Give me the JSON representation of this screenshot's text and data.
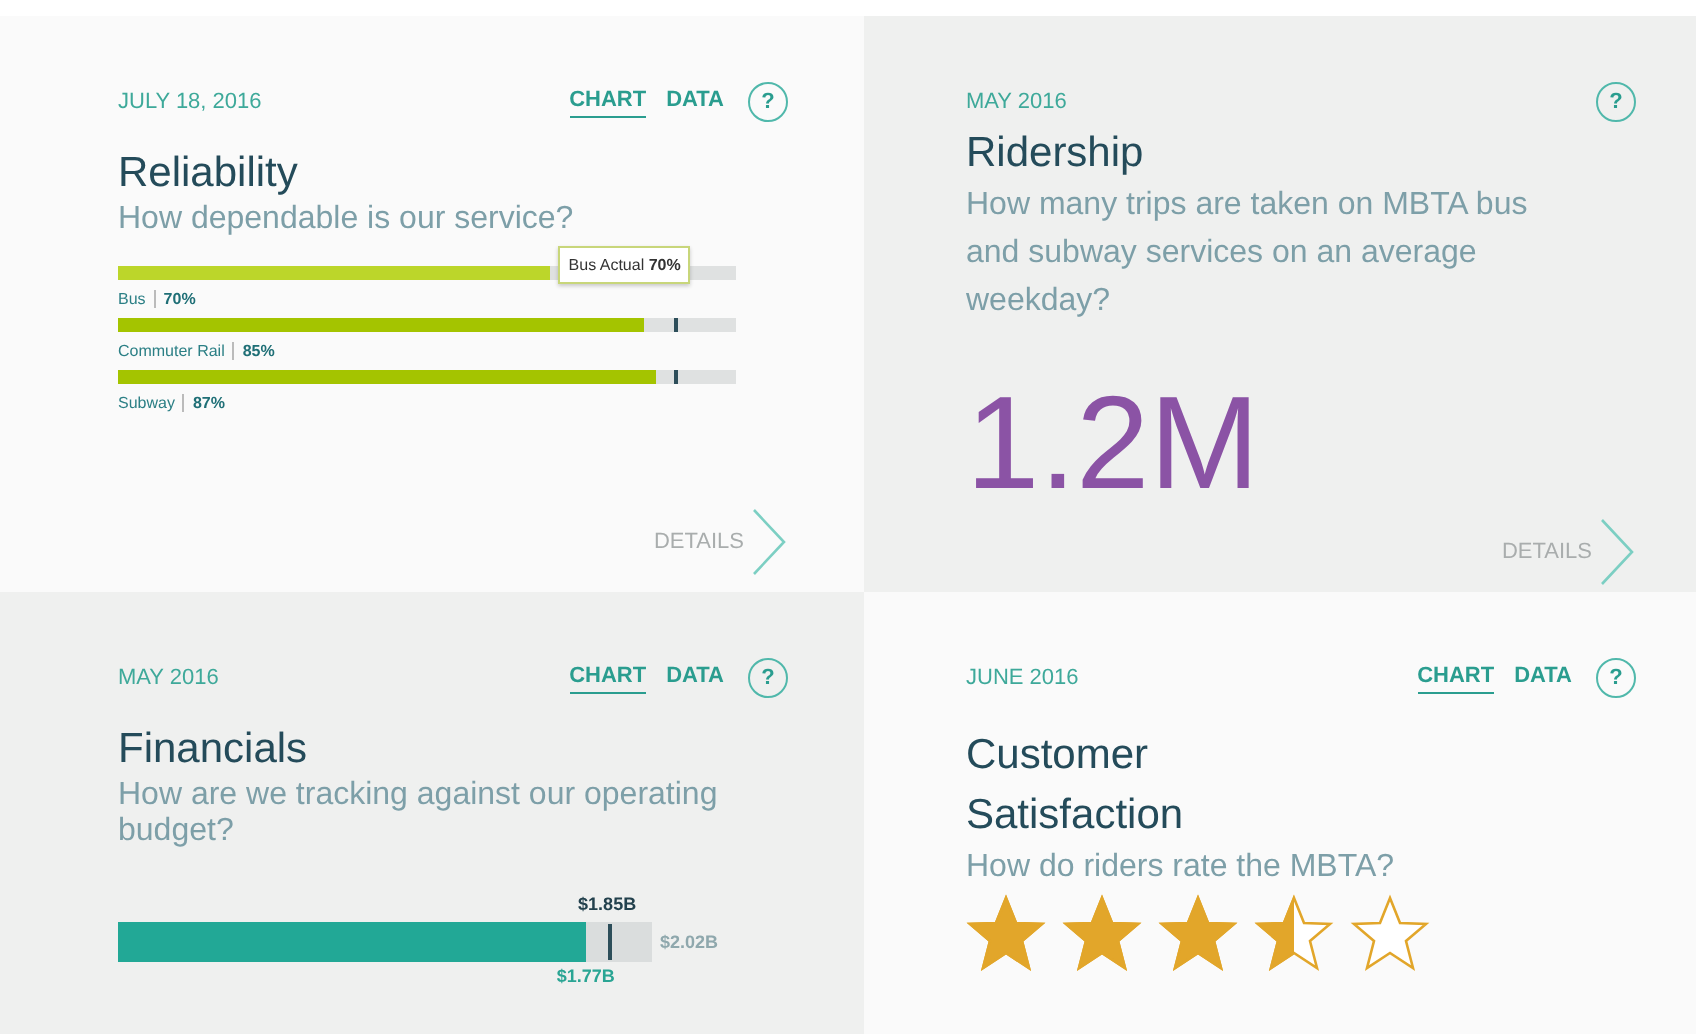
{
  "cards": [
    {
      "kind": "reliability",
      "date": "JULY 18, 2016",
      "tabs": [
        {
          "label": "CHART",
          "selected": true
        },
        {
          "label": "DATA",
          "selected": false
        }
      ],
      "help": "?",
      "title": "Reliability",
      "question": "How dependable is our service?",
      "bars": [
        {
          "name": "Bus",
          "value": "70%",
          "level": 0.7,
          "tooltip": "Bus Actual **70%**"
        },
        {
          "name": "Commuter Rail",
          "value": "85%",
          "level": 0.85,
          "target": {
            "level": 0.9
          }
        },
        {
          "name": "Subway",
          "value": "87%",
          "level": 0.87,
          "target": {
            "level": 0.9
          }
        }
      ],
      "details": "DETAILS"
    },
    {
      "kind": "ridership",
      "date": "MAY 2016",
      "help": "?",
      "title": "Ridership",
      "question": "How many trips are taken on MBTA bus and subway services on an average weekday?",
      "big_number": "1.2M",
      "details": "DETAILS"
    },
    {
      "kind": "financials",
      "date": "MAY 2016",
      "tabs": [
        {
          "label": "CHART",
          "selected": true
        },
        {
          "label": "DATA",
          "selected": false
        }
      ],
      "help": "?",
      "title": "Financials",
      "question": "How are we tracking against our operating budget?",
      "budget": {
        "level": 0.876,
        "actual": "$1.77B",
        "target": {
          "level": 0.916,
          "label": "$1.85B"
        },
        "total": "$2.02B"
      }
    },
    {
      "kind": "satisfaction",
      "date": "JUNE 2016",
      "tabs": [
        {
          "label": "CHART",
          "selected": true
        },
        {
          "label": "DATA",
          "selected": false
        }
      ],
      "help": "?",
      "title": "Customer Satisfaction",
      "question": "How do riders rate the MBTA?",
      "stars": 3.5
    }
  ]
}
